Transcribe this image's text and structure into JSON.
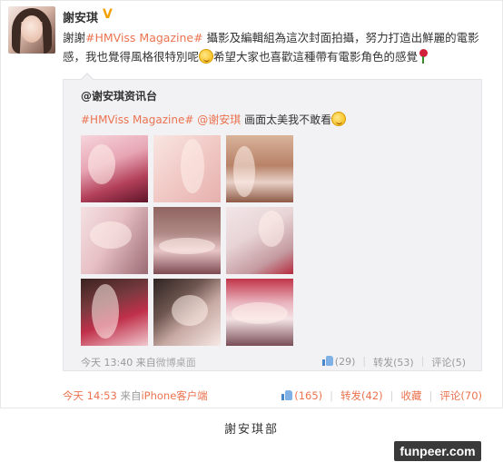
{
  "post": {
    "author": "謝安琪",
    "verified_badge": "V",
    "text_prefix": "謝謝",
    "topic": "#HMViss Magazine#",
    "text_body_1": " 攝影及編輯組為這次封面拍攝，努力打造出鮮麗的電影感，我也覺得風格很特別呢",
    "text_body_2": "希望大家也喜歡這種帶有電影角色的感覺",
    "time": "今天 14:53",
    "source_prefix": "来自",
    "source": "iPhone客户端",
    "actions": {
      "like": "(165)",
      "repost": "转发(42)",
      "favorite": "收藏",
      "comment": "评论(70)"
    }
  },
  "quoted": {
    "author": "@谢安琪资讯台",
    "topic": "#HMViss Magazine#",
    "mention": "@谢安琪",
    "text": "画面太美我不敢看",
    "time": "今天 13:40",
    "source_prefix": "来自",
    "source": "微博桌面",
    "actions": {
      "like": "(29)",
      "repost": "转发(53)",
      "comment": "评论(5)"
    }
  },
  "caption": "謝安琪部",
  "watermark": "funpeer.com",
  "colors": {
    "link": "#eb7350",
    "quote_bg": "#f2f2f5",
    "verified": "#f3a000"
  }
}
